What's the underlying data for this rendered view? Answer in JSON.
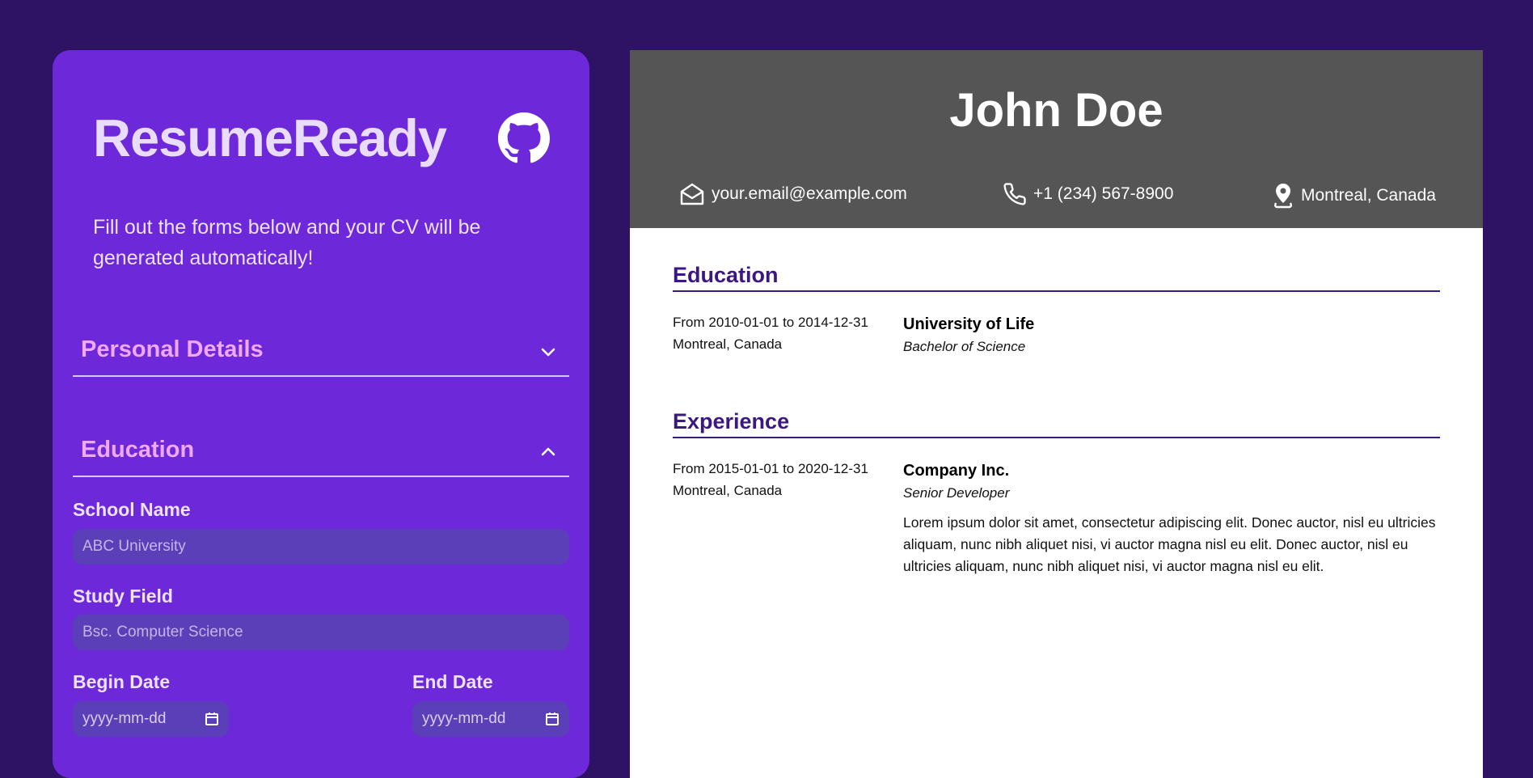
{
  "app": {
    "title": "ResumeReady",
    "intro": "Fill out the forms below and your CV will be generated automatically!",
    "icons": {
      "github": "github-icon"
    }
  },
  "form": {
    "sections": [
      {
        "title": "Personal Details",
        "expanded": false,
        "icon": "chevron-down-icon"
      },
      {
        "title": "Education",
        "expanded": true,
        "icon": "chevron-up-icon"
      }
    ],
    "education": {
      "school_label": "School Name",
      "school_placeholder": "ABC University",
      "field_label": "Study Field",
      "field_placeholder": "Bsc. Computer Science",
      "begin_label": "Begin Date",
      "begin_placeholder": "yyyy-mm-dd",
      "end_label": "End Date",
      "end_placeholder": "yyyy-mm-dd"
    }
  },
  "resume": {
    "name": "John Doe",
    "contacts": {
      "email": "your.email@example.com",
      "phone": "+1 (234) 567-8900",
      "location": "Montreal, Canada"
    },
    "education": {
      "heading": "Education",
      "entries": [
        {
          "dates": "From 2010-01-01 to 2014-12-31",
          "location": "Montreal, Canada",
          "school": "University of Life",
          "degree": "Bachelor of Science"
        }
      ]
    },
    "experience": {
      "heading": "Experience",
      "entries": [
        {
          "dates": "From 2015-01-01 to 2020-12-31",
          "location": "Montreal, Canada",
          "company": "Company Inc.",
          "role": "Senior Developer",
          "description": "Lorem ipsum dolor sit amet, consectetur adipiscing elit. Donec auctor, nisl eu ultricies aliquam, nunc nibh aliquet nisi, vi auctor magna nisl eu elit. Donec auctor, nisl eu ultricies aliquam, nunc nibh aliquet nisi, vi auctor magna nisl eu elit."
        }
      ]
    }
  },
  "colors": {
    "page_background": "#2e1264",
    "panel_background": "#6d28d9",
    "section_title": "#f0a9f8",
    "input_background": "#5b3fb8",
    "resume_header": "#555555",
    "resume_accent": "#3b1782"
  }
}
